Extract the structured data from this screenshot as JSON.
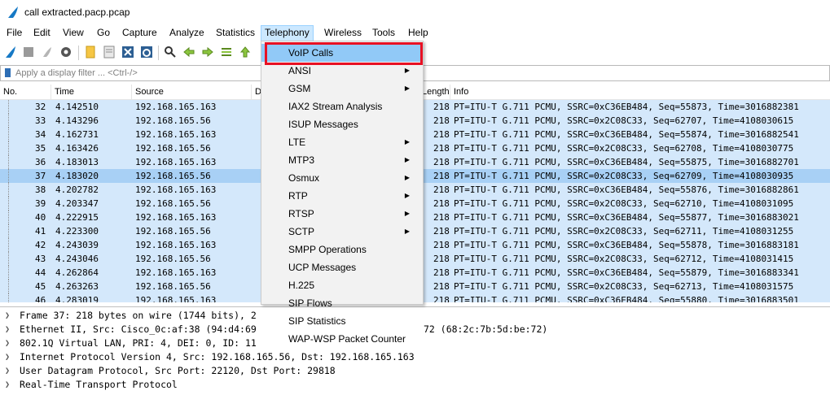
{
  "window": {
    "title": "call extracted.pacp.pcap"
  },
  "menubar": [
    "File",
    "Edit",
    "View",
    "Go",
    "Capture",
    "Analyze",
    "Statistics",
    "Telephony",
    "Wireless",
    "Tools",
    "Help"
  ],
  "filter": {
    "placeholder": "Apply a display filter ... <Ctrl-/>"
  },
  "columns": {
    "no": "No.",
    "time": "Time",
    "source": "Source",
    "dest_partial": "D",
    "length_partial": "Length",
    "info": "Info"
  },
  "packets": [
    {
      "no": "32",
      "time": "4.142510",
      "src": "192.168.165.163",
      "len": "218",
      "info": "PT=ITU-T G.711 PCMU, SSRC=0xC36EB484, Seq=55873, Time=3016882381"
    },
    {
      "no": "33",
      "time": "4.143296",
      "src": "192.168.165.56",
      "len": "218",
      "info": "PT=ITU-T G.711 PCMU, SSRC=0x2C08C33, Seq=62707, Time=4108030615"
    },
    {
      "no": "34",
      "time": "4.162731",
      "src": "192.168.165.163",
      "len": "218",
      "info": "PT=ITU-T G.711 PCMU, SSRC=0xC36EB484, Seq=55874, Time=3016882541"
    },
    {
      "no": "35",
      "time": "4.163426",
      "src": "192.168.165.56",
      "len": "218",
      "info": "PT=ITU-T G.711 PCMU, SSRC=0x2C08C33, Seq=62708, Time=4108030775"
    },
    {
      "no": "36",
      "time": "4.183013",
      "src": "192.168.165.163",
      "len": "218",
      "info": "PT=ITU-T G.711 PCMU, SSRC=0xC36EB484, Seq=55875, Time=3016882701"
    },
    {
      "no": "37",
      "time": "4.183020",
      "src": "192.168.165.56",
      "len": "218",
      "info": "PT=ITU-T G.711 PCMU, SSRC=0x2C08C33, Seq=62709, Time=4108030935"
    },
    {
      "no": "38",
      "time": "4.202782",
      "src": "192.168.165.163",
      "len": "218",
      "info": "PT=ITU-T G.711 PCMU, SSRC=0xC36EB484, Seq=55876, Time=3016882861"
    },
    {
      "no": "39",
      "time": "4.203347",
      "src": "192.168.165.56",
      "len": "218",
      "info": "PT=ITU-T G.711 PCMU, SSRC=0x2C08C33, Seq=62710, Time=4108031095"
    },
    {
      "no": "40",
      "time": "4.222915",
      "src": "192.168.165.163",
      "len": "218",
      "info": "PT=ITU-T G.711 PCMU, SSRC=0xC36EB484, Seq=55877, Time=3016883021"
    },
    {
      "no": "41",
      "time": "4.223300",
      "src": "192.168.165.56",
      "len": "218",
      "info": "PT=ITU-T G.711 PCMU, SSRC=0x2C08C33, Seq=62711, Time=4108031255"
    },
    {
      "no": "42",
      "time": "4.243039",
      "src": "192.168.165.163",
      "len": "218",
      "info": "PT=ITU-T G.711 PCMU, SSRC=0xC36EB484, Seq=55878, Time=3016883181"
    },
    {
      "no": "43",
      "time": "4.243046",
      "src": "192.168.165.56",
      "len": "218",
      "info": "PT=ITU-T G.711 PCMU, SSRC=0x2C08C33, Seq=62712, Time=4108031415"
    },
    {
      "no": "44",
      "time": "4.262864",
      "src": "192.168.165.163",
      "len": "218",
      "info": "PT=ITU-T G.711 PCMU, SSRC=0xC36EB484, Seq=55879, Time=3016883341"
    },
    {
      "no": "45",
      "time": "4.263263",
      "src": "192.168.165.56",
      "len": "218",
      "info": "PT=ITU-T G.711 PCMU, SSRC=0x2C08C33, Seq=62713, Time=4108031575"
    },
    {
      "no": "46",
      "time": "4.283019",
      "src": "192.168.165.163",
      "len": "218",
      "info": "PT=ITU-T G.711 PCMU, SSRC=0xC36EB484, Seq=55880, Time=3016883501"
    }
  ],
  "selected_packet": "37",
  "details": [
    {
      "left": "Frame 37: 218 bytes on wire (1744 bits), 2",
      "right": ""
    },
    {
      "left": "Ethernet II, Src: Cisco_0c:af:38 (94:d4:69",
      "right": "72 (68:2c:7b:5d:be:72)"
    },
    {
      "left": "802.1Q Virtual LAN, PRI: 4, DEI: 0, ID: 11",
      "right": ""
    },
    {
      "left": "Internet Protocol Version 4, Src: 192.168.165.56, Dst: 192.168.165.163",
      "right": ""
    },
    {
      "left": "User Datagram Protocol, Src Port: 22120, Dst Port: 29818",
      "right": ""
    },
    {
      "left": "Real-Time Transport Protocol",
      "right": ""
    }
  ],
  "telephony_menu": [
    {
      "label": "VoIP Calls",
      "submenu": false,
      "highlighted": true
    },
    {
      "label": "ANSI",
      "submenu": true
    },
    {
      "label": "GSM",
      "submenu": true
    },
    {
      "label": "IAX2 Stream Analysis",
      "submenu": false
    },
    {
      "label": "ISUP Messages",
      "submenu": false
    },
    {
      "label": "LTE",
      "submenu": true
    },
    {
      "label": "MTP3",
      "submenu": true
    },
    {
      "label": "Osmux",
      "submenu": true
    },
    {
      "label": "RTP",
      "submenu": true
    },
    {
      "label": "RTSP",
      "submenu": true
    },
    {
      "label": "SCTP",
      "submenu": true
    },
    {
      "label": "SMPP Operations",
      "submenu": false
    },
    {
      "label": "UCP Messages",
      "submenu": false
    },
    {
      "label": "H.225",
      "submenu": false
    },
    {
      "label": "SIP Flows",
      "submenu": false
    },
    {
      "label": "SIP Statistics",
      "submenu": false
    },
    {
      "label": "WAP-WSP Packet Counter",
      "submenu": false
    }
  ],
  "colors": {
    "accent_highlight": "#91c9f7",
    "annotation_box": "#e81123",
    "selected_row": "#a8d0f5"
  }
}
